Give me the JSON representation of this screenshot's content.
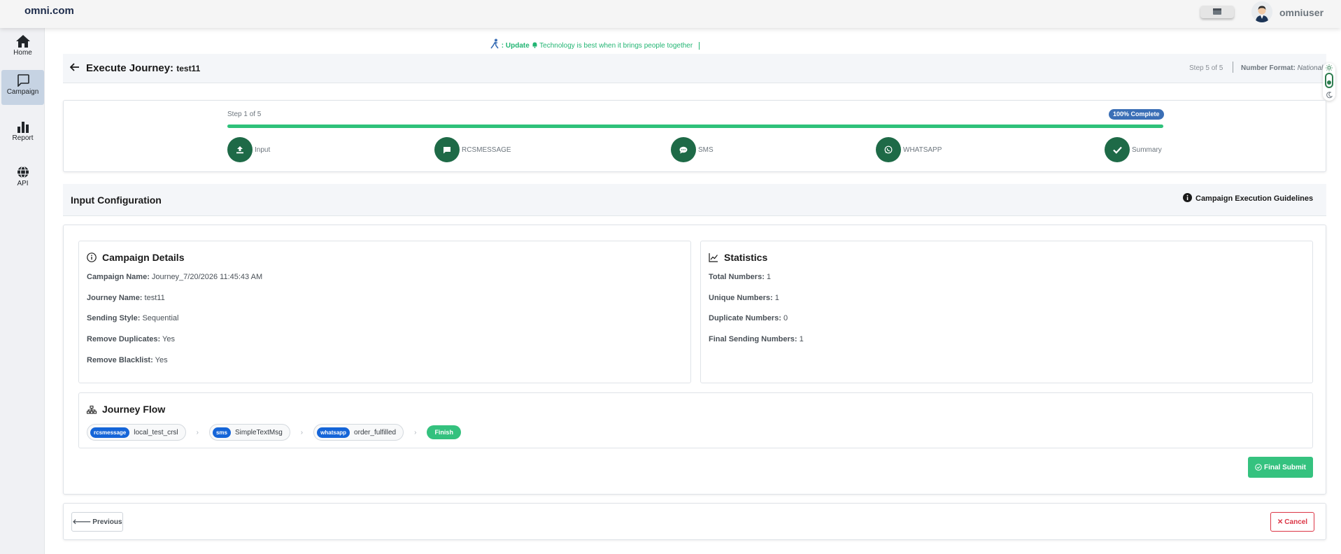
{
  "topbar": {
    "brand": "omni.com",
    "username": "omniuser"
  },
  "sidebar": {
    "items": [
      {
        "label": "Home",
        "icon": "home-icon",
        "active": false
      },
      {
        "label": "Campaign",
        "icon": "chat-icon",
        "active": true
      },
      {
        "label": "Report",
        "icon": "bar-chart-icon",
        "active": false
      },
      {
        "label": "API",
        "icon": "globe-icon",
        "active": false
      }
    ]
  },
  "ticker": {
    "prefix": ": Update",
    "message": "Technology is best when it brings people together"
  },
  "header": {
    "title": "Execute Journey:",
    "journey": "test11",
    "step_info": "Step 5 of 5",
    "number_format_label": "Number Format:",
    "number_format_value": "National"
  },
  "stepper": {
    "step_count": "Step 1 of 5",
    "badge": "100% Complete",
    "progress_percent": 100,
    "steps": [
      {
        "label": "Input",
        "icon": "upload-icon"
      },
      {
        "label": "RCSMESSAGE",
        "icon": "message-icon"
      },
      {
        "label": "SMS",
        "icon": "chat-bubble-icon"
      },
      {
        "label": "WHATSAPP",
        "icon": "whatsapp-icon"
      },
      {
        "label": "Summary",
        "icon": "check-icon"
      }
    ]
  },
  "config": {
    "title": "Input Configuration",
    "guidelines_label": "Campaign Execution Guidelines"
  },
  "campaign_details": {
    "title": "Campaign Details",
    "fields": [
      {
        "label": "Campaign Name:",
        "value": "Journey_7/20/2026 11:45:43 AM"
      },
      {
        "label": "Journey Name:",
        "value": "test11"
      },
      {
        "label": "Sending Style:",
        "value": "Sequential"
      },
      {
        "label": "Remove Duplicates:",
        "value": "Yes"
      },
      {
        "label": "Remove Blacklist:",
        "value": "Yes"
      }
    ]
  },
  "statistics": {
    "title": "Statistics",
    "fields": [
      {
        "label": "Total Numbers:",
        "value": "1"
      },
      {
        "label": "Unique Numbers:",
        "value": "1"
      },
      {
        "label": "Duplicate Numbers:",
        "value": "0"
      },
      {
        "label": "Final Sending Numbers:",
        "value": "1"
      }
    ]
  },
  "journey_flow": {
    "title": "Journey Flow",
    "nodes": [
      {
        "tag": "rcsmessage",
        "name": "local_test_crsl"
      },
      {
        "tag": "sms",
        "name": "SimpleTextMsg"
      },
      {
        "tag": "whatsapp",
        "name": "order_fulfilled"
      }
    ],
    "finish_label": "Finish"
  },
  "actions": {
    "final_submit": "Final Submit",
    "previous": "Previous",
    "cancel": "Cancel"
  },
  "colors": {
    "accent_green": "#2ec17a",
    "step_green": "#1e6a47",
    "badge_blue": "#3b6fb6",
    "tag_blue": "#1565d8",
    "cancel_red": "#dc3545"
  }
}
